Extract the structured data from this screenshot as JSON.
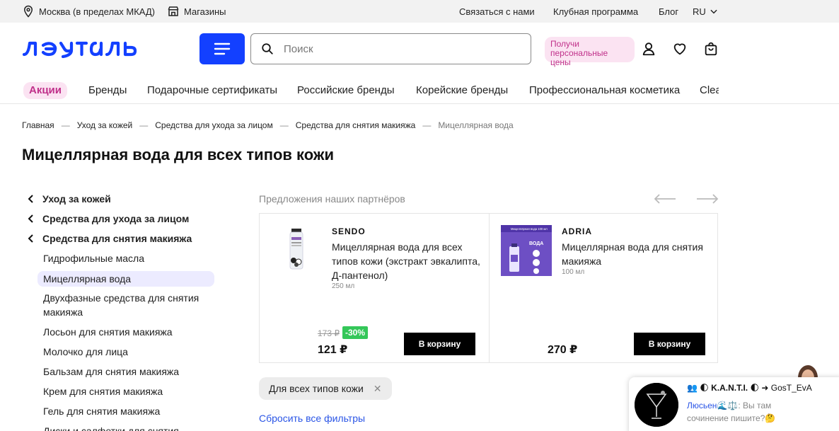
{
  "topbar": {
    "location": "Москва (в пределах МКАД)",
    "stores": "Магазины",
    "contact": "Связаться с нами",
    "club": "Клубная программа",
    "blog": "Блог",
    "lang": "RU"
  },
  "header": {
    "logo": "ЛЭТУАЛЬ",
    "search_placeholder": "Поиск",
    "promo_line1": "Получи",
    "promo_line2": "персональные цены"
  },
  "nav": {
    "items": [
      "Акции",
      "Бренды",
      "Подарочные сертификаты",
      "Российские бренды",
      "Корейские бренды",
      "Профессиональная косметика",
      "Clean"
    ]
  },
  "breadcrumbs": [
    "Главная",
    "Уход за кожей",
    "Средства для ухода за лицом",
    "Средства для снятия макияжа",
    "Мицеллярная вода"
  ],
  "page_title": "Мицеллярная вода для всех типов кожи",
  "sidebar": {
    "back": [
      "Уход за кожей",
      "Средства для ухода за лицом",
      "Средства для снятия макияжа"
    ],
    "items": [
      "Гидрофильные масла",
      "Мицеллярная вода",
      "Двухфазные средства для снятия макияжа",
      "Лосьон для снятия макияжа",
      "Молочко для лица",
      "Бальзам для снятия макияжа",
      "Крем для снятия макияжа",
      "Гель для снятия макияжа",
      "Диски и салфетки для снятия"
    ]
  },
  "partners": {
    "title": "Предложения наших партнёров",
    "cards": [
      {
        "brand": "SENDO",
        "name": "Мицеллярная вода для всех типов кожи (экстракт эвкалипта, Д-пантенол)",
        "volume": "250 мл",
        "old_price": "173 ₽",
        "discount": "-30%",
        "price": "121 ₽",
        "button": "В корзину"
      },
      {
        "brand": "ADRIA",
        "name": "Мицеллярная вода для снятия макияжа",
        "volume": "100 мл",
        "price": "270 ₽",
        "button": "В корзину",
        "image_text": "Мицеллярная вода 100 мл",
        "image_big": "ВОДА"
      }
    ]
  },
  "filter_chip": "Для всех типов кожи",
  "reset_filters": "Сбросить все фильтры",
  "chat": {
    "title": "K.A.N.T.I.",
    "arrow_to": "➜ GosT_EvA",
    "sender": "Люсьен",
    "message": ": Вы там сочинение пишите?🤔"
  },
  "colors": {
    "accent": "#1340ff",
    "promo": "#c0308a",
    "discount": "#34c759"
  }
}
